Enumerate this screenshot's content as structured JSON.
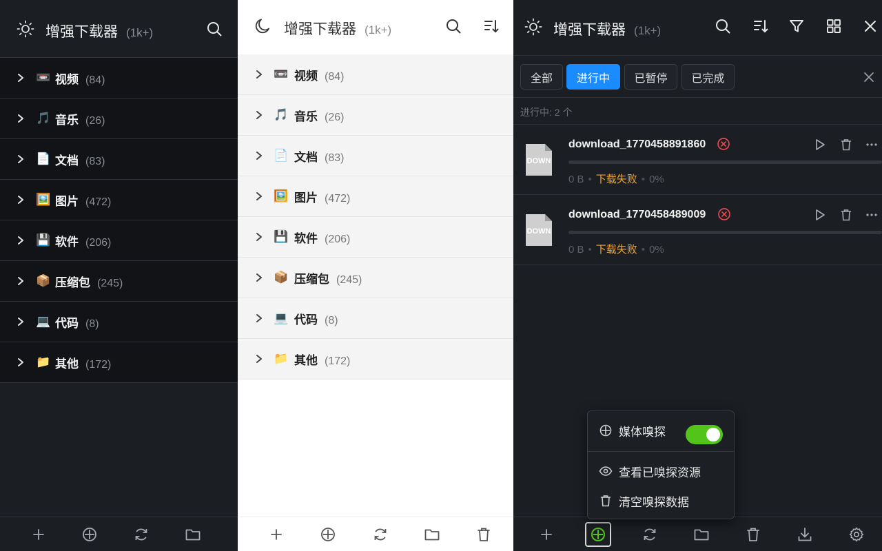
{
  "app": {
    "title": "增强下载器",
    "count": "(1k+)"
  },
  "categories": [
    {
      "emoji": "📼",
      "name": "视频",
      "count": "(84)"
    },
    {
      "emoji": "🎵",
      "name": "音乐",
      "count": "(26)"
    },
    {
      "emoji": "📄",
      "name": "文档",
      "count": "(83)"
    },
    {
      "emoji": "🖼️",
      "name": "图片",
      "count": "(472)"
    },
    {
      "emoji": "💾",
      "name": "软件",
      "count": "(206)"
    },
    {
      "emoji": "📦",
      "name": "压缩包",
      "count": "(245)"
    },
    {
      "emoji": "💻",
      "name": "代码",
      "count": "(8)"
    },
    {
      "emoji": "📁",
      "name": "其他",
      "count": "(172)"
    }
  ],
  "tabs": [
    {
      "label": "全部",
      "active": false
    },
    {
      "label": "进行中",
      "active": true
    },
    {
      "label": "已暂停",
      "active": false
    },
    {
      "label": "已完成",
      "active": false
    }
  ],
  "status_line": "进行中: 2 个",
  "downloads": [
    {
      "name": "download_1770458891860",
      "size": "0 B",
      "status": "下载失败",
      "progress": "0%",
      "file_icon_text": "DOWN"
    },
    {
      "name": "download_1770458489009",
      "size": "0 B",
      "status": "下载失败",
      "progress": "0%",
      "file_icon_text": "DOWN"
    }
  ],
  "popup": {
    "sniff_label": "媒体嗅探",
    "sniff_enabled": true,
    "view_label": "查看已嗅探资源",
    "clear_label": "清空嗅探数据"
  },
  "colors": {
    "accent": "#1a8cff",
    "toggle_on": "#52c41a",
    "error": "#e5484d",
    "failed_text": "#f5a623",
    "sniff_icon_active": "#52c41a"
  },
  "icons": [
    "sun-icon",
    "moon-icon",
    "search-icon",
    "sort-icon",
    "filter-icon",
    "grid-icon",
    "close-icon",
    "chevron-right-icon",
    "plus-icon",
    "crosshair-icon",
    "refresh-icon",
    "folder-icon",
    "trash-icon",
    "download-icon",
    "gear-icon",
    "play-icon",
    "more-icon",
    "error-circle-icon",
    "eye-icon"
  ]
}
